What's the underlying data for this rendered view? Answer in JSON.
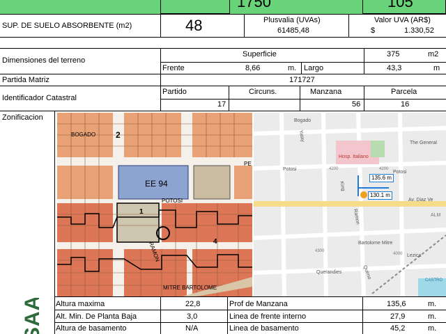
{
  "top_row": {
    "value_a": "1750",
    "value_b": "105"
  },
  "absorbent": {
    "label": "SUP. DE SUELO ABSORBENTE (m2)",
    "value": "48",
    "plusvalia_label": "Plusvalia (UVAs)",
    "plusvalia_value": "61485,48",
    "valor_uva_label": "Valor UVA (AR$)",
    "valor_uva_currency": "$",
    "valor_uva_value": "1.330,52"
  },
  "terreno": {
    "dimensiones_label": "Dimensiones del terreno",
    "superficie_label": "Superficie",
    "superficie_value": "375",
    "superficie_unit": "m2",
    "frente_label": "Frente",
    "frente_value": "8,66",
    "frente_unit": "m.",
    "largo_label": "Largo",
    "largo_value": "43,3",
    "largo_unit": "m",
    "partida_label": "Partida Matriz",
    "partida_value": "171727",
    "identificador_label": "Identificador Catastral",
    "partido_label": "Partido",
    "partido_value": "17",
    "circuns_label": "Circuns.",
    "manzana_label": "Manzana",
    "manzana_value": "56",
    "parcela_label": "Parcela",
    "parcela_value": "16"
  },
  "zonificacion": {
    "label": "Zonificacion",
    "side_code": "SAA"
  },
  "map_left": {
    "labels": {
      "bogado": "BOGADO",
      "block_num_2": "2",
      "ee94": "EE 94",
      "potosi": "POTOSI",
      "block_num_1": "1",
      "ramon": "RAMON",
      "block_num_4": "4",
      "mitre": "MITRE  BARTOLOME",
      "pe": "PE"
    }
  },
  "map_right": {
    "labels": {
      "bogado": "Bogado",
      "yatay": "Yatay",
      "general": "The General",
      "hosp": "Hosp. Italiano",
      "potosi1": "Potosi",
      "potosi2": "Potosi",
      "num_4200a": "4200",
      "num_4200b": "4200",
      "dist1": "135.6 m",
      "dist2": "130.1 m",
      "diaz": "Av. Diaz Ve",
      "alm": "ALM",
      "ramon": "Ramon",
      "king": "King",
      "bartolome": "Bartolome Mitre",
      "quirno": "Quirno",
      "querandies": "Querandies",
      "lezica": "Lezica",
      "castro": "CASTRO",
      "num_4300": "4300",
      "num_4000": "4000"
    }
  },
  "bottom_table": {
    "rows": [
      {
        "label": "Altura maxima",
        "value": "22,8",
        "label2": "Prof de Manzana",
        "value2": "135,6",
        "unit2": "m."
      },
      {
        "label": "Alt. Min. De Planta Baja",
        "value": "3,0",
        "label2": "Linea de frente interno",
        "value2": "27,9",
        "unit2": "m."
      },
      {
        "label": "Altura de basamento",
        "value": "N/A",
        "label2": "Linea de basamento",
        "value2": "45,2",
        "unit2": "m."
      }
    ]
  }
}
